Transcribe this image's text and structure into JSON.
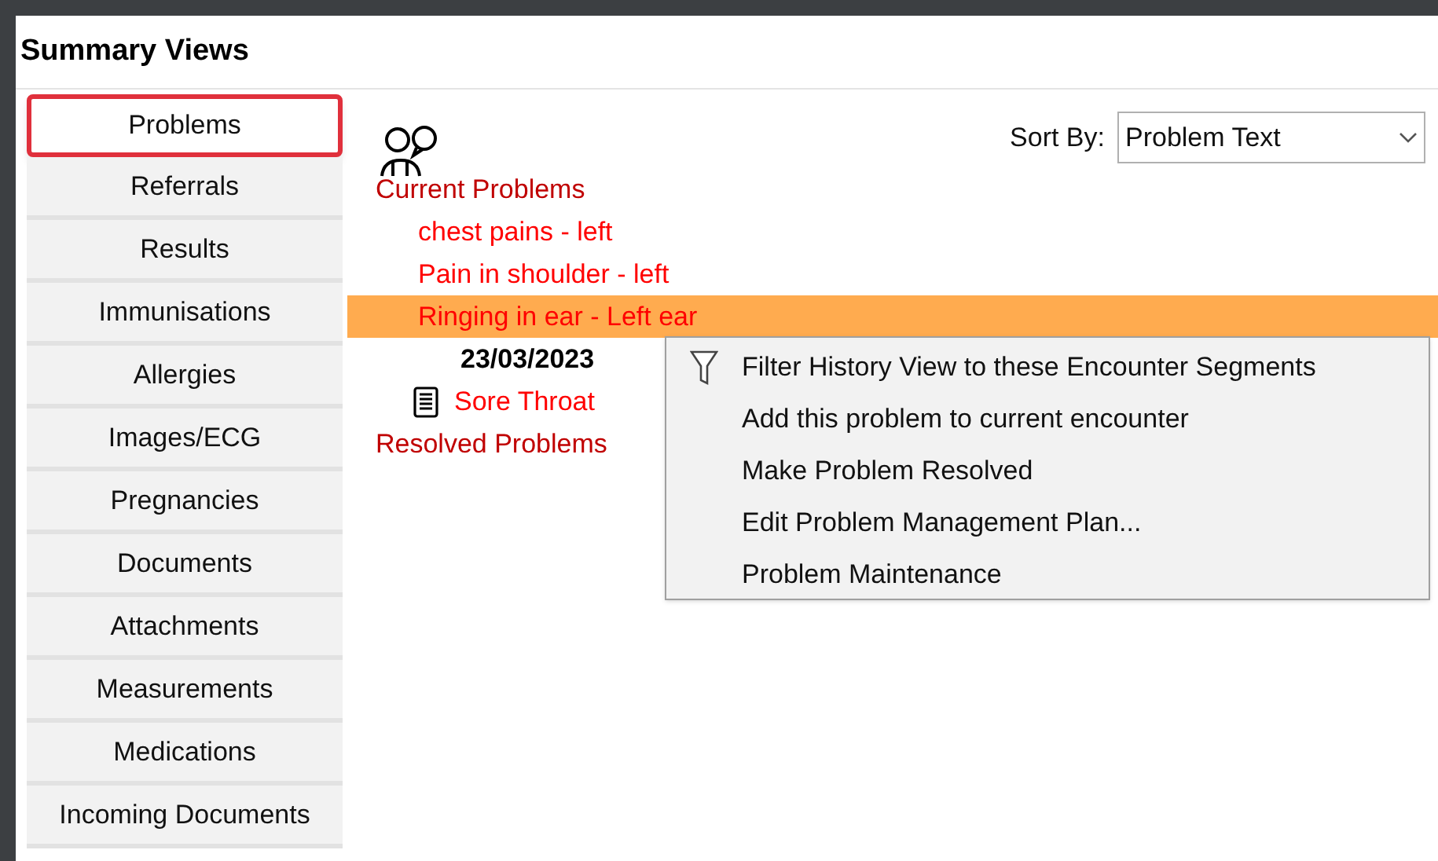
{
  "title": "Summary Views",
  "sidebar": {
    "items": [
      {
        "label": "Problems",
        "selected": true
      },
      {
        "label": "Referrals",
        "selected": false
      },
      {
        "label": "Results",
        "selected": false
      },
      {
        "label": "Immunisations",
        "selected": false
      },
      {
        "label": "Allergies",
        "selected": false
      },
      {
        "label": "Images/ECG",
        "selected": false
      },
      {
        "label": "Pregnancies",
        "selected": false
      },
      {
        "label": "Documents",
        "selected": false
      },
      {
        "label": "Attachments",
        "selected": false
      },
      {
        "label": "Measurements",
        "selected": false
      },
      {
        "label": "Medications",
        "selected": false
      },
      {
        "label": "Incoming Documents",
        "selected": false
      }
    ]
  },
  "sort": {
    "label": "Sort By:",
    "value": "Problem Text"
  },
  "tree": [
    {
      "kind": "group",
      "label": "Current Problems",
      "children": [
        {
          "kind": "problem",
          "label": "chest pains - left",
          "selected": false
        },
        {
          "kind": "problem",
          "label": "Pain in shoulder - left",
          "selected": false
        },
        {
          "kind": "problem",
          "label": "Ringing in ear - Left ear",
          "selected": true,
          "children": [
            {
              "kind": "date",
              "label": "23/03/2023"
            },
            {
              "kind": "encounter",
              "label": "Sore Throat"
            }
          ]
        }
      ]
    },
    {
      "kind": "group",
      "label": "Resolved Problems"
    }
  ],
  "context_menu": {
    "items": [
      {
        "kind": "filter",
        "label": "Filter History View to these Encounter Segments"
      },
      {
        "kind": "plain",
        "label": "Add this problem to current encounter"
      },
      {
        "kind": "plain",
        "label": "Make Problem Resolved"
      },
      {
        "kind": "plain",
        "label": "Edit Problem Management Plan..."
      },
      {
        "kind": "plain",
        "label": "Problem Maintenance"
      }
    ]
  }
}
